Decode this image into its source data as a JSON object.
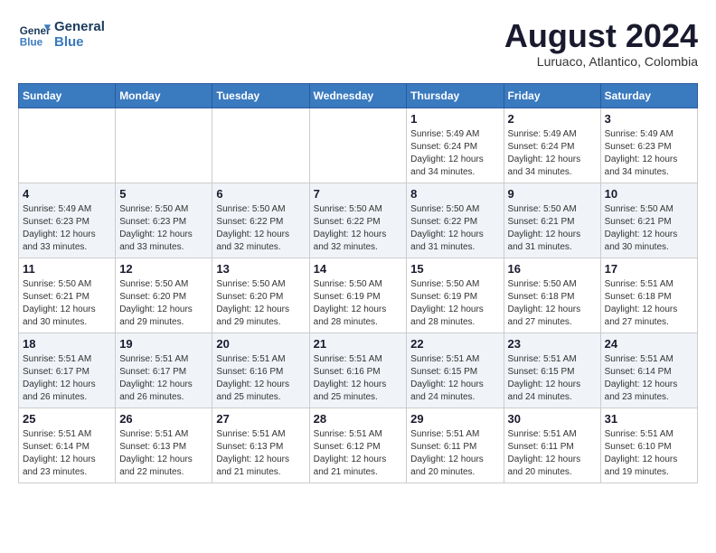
{
  "header": {
    "logo_line1": "General",
    "logo_line2": "Blue",
    "month_year": "August 2024",
    "location": "Luruaco, Atlantico, Colombia"
  },
  "weekdays": [
    "Sunday",
    "Monday",
    "Tuesday",
    "Wednesday",
    "Thursday",
    "Friday",
    "Saturday"
  ],
  "weeks": [
    [
      {
        "day": "",
        "info": ""
      },
      {
        "day": "",
        "info": ""
      },
      {
        "day": "",
        "info": ""
      },
      {
        "day": "",
        "info": ""
      },
      {
        "day": "1",
        "info": "Sunrise: 5:49 AM\nSunset: 6:24 PM\nDaylight: 12 hours\nand 34 minutes."
      },
      {
        "day": "2",
        "info": "Sunrise: 5:49 AM\nSunset: 6:24 PM\nDaylight: 12 hours\nand 34 minutes."
      },
      {
        "day": "3",
        "info": "Sunrise: 5:49 AM\nSunset: 6:23 PM\nDaylight: 12 hours\nand 34 minutes."
      }
    ],
    [
      {
        "day": "4",
        "info": "Sunrise: 5:49 AM\nSunset: 6:23 PM\nDaylight: 12 hours\nand 33 minutes."
      },
      {
        "day": "5",
        "info": "Sunrise: 5:50 AM\nSunset: 6:23 PM\nDaylight: 12 hours\nand 33 minutes."
      },
      {
        "day": "6",
        "info": "Sunrise: 5:50 AM\nSunset: 6:22 PM\nDaylight: 12 hours\nand 32 minutes."
      },
      {
        "day": "7",
        "info": "Sunrise: 5:50 AM\nSunset: 6:22 PM\nDaylight: 12 hours\nand 32 minutes."
      },
      {
        "day": "8",
        "info": "Sunrise: 5:50 AM\nSunset: 6:22 PM\nDaylight: 12 hours\nand 31 minutes."
      },
      {
        "day": "9",
        "info": "Sunrise: 5:50 AM\nSunset: 6:21 PM\nDaylight: 12 hours\nand 31 minutes."
      },
      {
        "day": "10",
        "info": "Sunrise: 5:50 AM\nSunset: 6:21 PM\nDaylight: 12 hours\nand 30 minutes."
      }
    ],
    [
      {
        "day": "11",
        "info": "Sunrise: 5:50 AM\nSunset: 6:21 PM\nDaylight: 12 hours\nand 30 minutes."
      },
      {
        "day": "12",
        "info": "Sunrise: 5:50 AM\nSunset: 6:20 PM\nDaylight: 12 hours\nand 29 minutes."
      },
      {
        "day": "13",
        "info": "Sunrise: 5:50 AM\nSunset: 6:20 PM\nDaylight: 12 hours\nand 29 minutes."
      },
      {
        "day": "14",
        "info": "Sunrise: 5:50 AM\nSunset: 6:19 PM\nDaylight: 12 hours\nand 28 minutes."
      },
      {
        "day": "15",
        "info": "Sunrise: 5:50 AM\nSunset: 6:19 PM\nDaylight: 12 hours\nand 28 minutes."
      },
      {
        "day": "16",
        "info": "Sunrise: 5:50 AM\nSunset: 6:18 PM\nDaylight: 12 hours\nand 27 minutes."
      },
      {
        "day": "17",
        "info": "Sunrise: 5:51 AM\nSunset: 6:18 PM\nDaylight: 12 hours\nand 27 minutes."
      }
    ],
    [
      {
        "day": "18",
        "info": "Sunrise: 5:51 AM\nSunset: 6:17 PM\nDaylight: 12 hours\nand 26 minutes."
      },
      {
        "day": "19",
        "info": "Sunrise: 5:51 AM\nSunset: 6:17 PM\nDaylight: 12 hours\nand 26 minutes."
      },
      {
        "day": "20",
        "info": "Sunrise: 5:51 AM\nSunset: 6:16 PM\nDaylight: 12 hours\nand 25 minutes."
      },
      {
        "day": "21",
        "info": "Sunrise: 5:51 AM\nSunset: 6:16 PM\nDaylight: 12 hours\nand 25 minutes."
      },
      {
        "day": "22",
        "info": "Sunrise: 5:51 AM\nSunset: 6:15 PM\nDaylight: 12 hours\nand 24 minutes."
      },
      {
        "day": "23",
        "info": "Sunrise: 5:51 AM\nSunset: 6:15 PM\nDaylight: 12 hours\nand 24 minutes."
      },
      {
        "day": "24",
        "info": "Sunrise: 5:51 AM\nSunset: 6:14 PM\nDaylight: 12 hours\nand 23 minutes."
      }
    ],
    [
      {
        "day": "25",
        "info": "Sunrise: 5:51 AM\nSunset: 6:14 PM\nDaylight: 12 hours\nand 23 minutes."
      },
      {
        "day": "26",
        "info": "Sunrise: 5:51 AM\nSunset: 6:13 PM\nDaylight: 12 hours\nand 22 minutes."
      },
      {
        "day": "27",
        "info": "Sunrise: 5:51 AM\nSunset: 6:13 PM\nDaylight: 12 hours\nand 21 minutes."
      },
      {
        "day": "28",
        "info": "Sunrise: 5:51 AM\nSunset: 6:12 PM\nDaylight: 12 hours\nand 21 minutes."
      },
      {
        "day": "29",
        "info": "Sunrise: 5:51 AM\nSunset: 6:11 PM\nDaylight: 12 hours\nand 20 minutes."
      },
      {
        "day": "30",
        "info": "Sunrise: 5:51 AM\nSunset: 6:11 PM\nDaylight: 12 hours\nand 20 minutes."
      },
      {
        "day": "31",
        "info": "Sunrise: 5:51 AM\nSunset: 6:10 PM\nDaylight: 12 hours\nand 19 minutes."
      }
    ]
  ]
}
